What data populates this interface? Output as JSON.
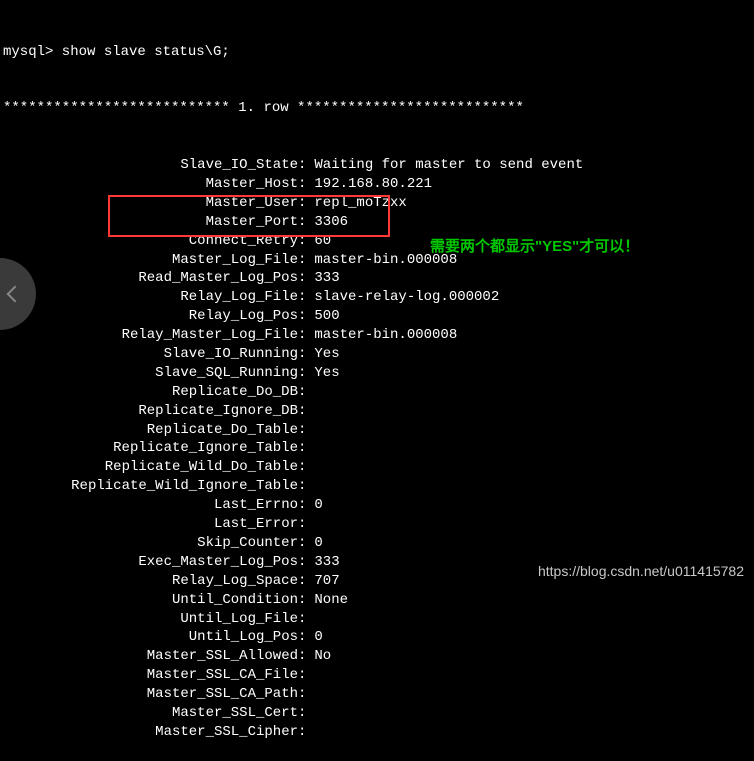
{
  "prompt": "mysql> show slave status\\G;",
  "separator": "*************************** 1. row ***************************",
  "fields": [
    {
      "label": "Slave_IO_State",
      "value": "Waiting for master to send event"
    },
    {
      "label": "Master_Host",
      "value": "192.168.80.221"
    },
    {
      "label": "Master_User",
      "value": "repl_moTzxx"
    },
    {
      "label": "Master_Port",
      "value": "3306"
    },
    {
      "label": "Connect_Retry",
      "value": "60"
    },
    {
      "label": "Master_Log_File",
      "value": "master-bin.000008"
    },
    {
      "label": "Read_Master_Log_Pos",
      "value": "333"
    },
    {
      "label": "Relay_Log_File",
      "value": "slave-relay-log.000002"
    },
    {
      "label": "Relay_Log_Pos",
      "value": "500"
    },
    {
      "label": "Relay_Master_Log_File",
      "value": "master-bin.000008"
    },
    {
      "label": "Slave_IO_Running",
      "value": "Yes"
    },
    {
      "label": "Slave_SQL_Running",
      "value": "Yes"
    },
    {
      "label": "Replicate_Do_DB",
      "value": ""
    },
    {
      "label": "Replicate_Ignore_DB",
      "value": ""
    },
    {
      "label": "Replicate_Do_Table",
      "value": ""
    },
    {
      "label": "Replicate_Ignore_Table",
      "value": ""
    },
    {
      "label": "Replicate_Wild_Do_Table",
      "value": ""
    },
    {
      "label": "Replicate_Wild_Ignore_Table",
      "value": ""
    },
    {
      "label": "Last_Errno",
      "value": "0"
    },
    {
      "label": "Last_Error",
      "value": ""
    },
    {
      "label": "Skip_Counter",
      "value": "0"
    },
    {
      "label": "Exec_Master_Log_Pos",
      "value": "333"
    },
    {
      "label": "Relay_Log_Space",
      "value": "707"
    },
    {
      "label": "Until_Condition",
      "value": "None"
    },
    {
      "label": "Until_Log_File",
      "value": ""
    },
    {
      "label": "Until_Log_Pos",
      "value": "0"
    },
    {
      "label": "Master_SSL_Allowed",
      "value": "No"
    },
    {
      "label": "Master_SSL_CA_File",
      "value": ""
    },
    {
      "label": "Master_SSL_CA_Path",
      "value": ""
    },
    {
      "label": "Master_SSL_Cert",
      "value": ""
    },
    {
      "label": "Master_SSL_Cipher",
      "value": ""
    }
  ],
  "annotation": "需要两个都显示\"YES\"才可以！",
  "watermark": "https://blog.csdn.net/u011415782"
}
